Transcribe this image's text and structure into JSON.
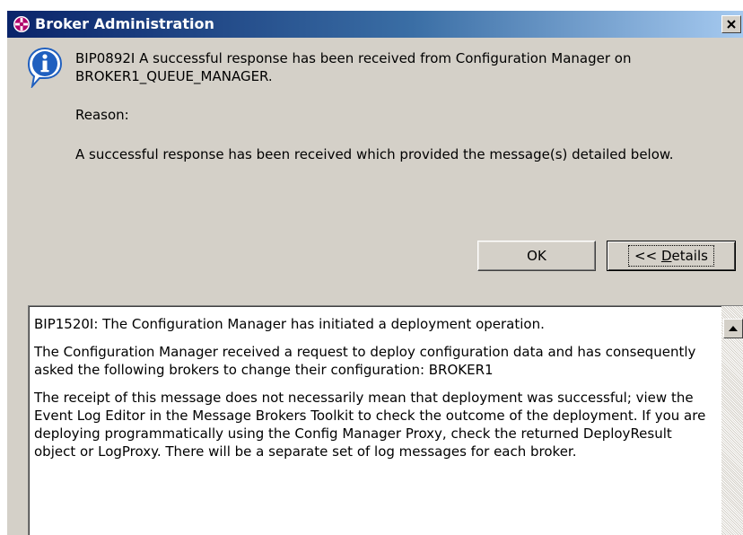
{
  "window": {
    "title": "Broker Administration",
    "app_icon": "broker-admin-icon",
    "close_icon": "close-icon"
  },
  "message": {
    "icon": "info-icon",
    "main_text": "BIP0892I A successful response has been received from Configuration Manager on BROKER1_QUEUE_MANAGER.",
    "reason_label": "Reason:",
    "reason_text": "A successful response has been received which provided the message(s) detailed below."
  },
  "buttons": {
    "ok_label": "OK",
    "details_prefix": "<< ",
    "details_mnemonic": "D",
    "details_rest": "etails"
  },
  "details": {
    "paragraphs": [
      "BIP1520I: The Configuration Manager has initiated a deployment operation.",
      "The Configuration Manager received a request to deploy configuration data and has consequently asked the following brokers to change their configuration: BROKER1",
      "The receipt of this message does not necessarily mean that deployment was successful; view the Event Log Editor in the Message Brokers Toolkit to check the outcome of the deployment. If you are deploying programmatically using the Config Manager Proxy, check the returned DeployResult object or LogProxy. There will be a separate set of log messages for each broker."
    ],
    "scroll_up_icon": "scroll-up-arrow-icon"
  },
  "colors": {
    "titlebar_start": "#0a246a",
    "titlebar_end": "#a6caf0",
    "dialog_bg": "#d4d0c8",
    "info_icon_blue": "#1f5fbf"
  }
}
